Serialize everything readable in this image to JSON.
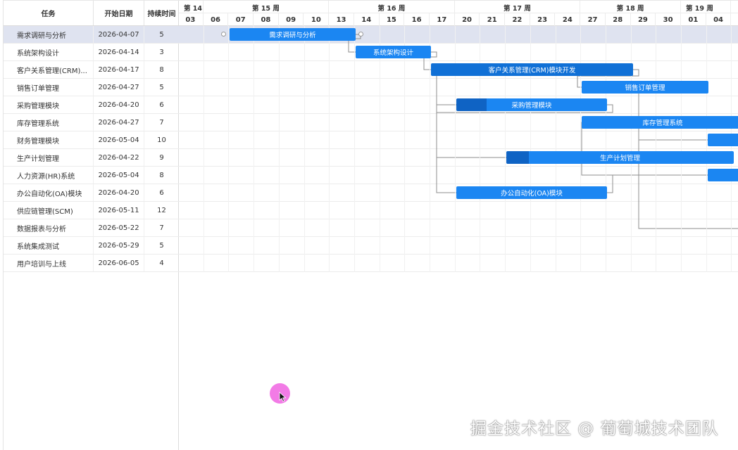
{
  "grid": {
    "headers": {
      "name": "任务",
      "start": "开始日期",
      "duration": "持续时间"
    },
    "rows": [
      {
        "name": "需求调研与分析",
        "start": "2026-04-07",
        "duration": "5"
      },
      {
        "name": "系统架构设计",
        "start": "2026-04-14",
        "duration": "3"
      },
      {
        "name": "客户关系管理(CRM)...",
        "start": "2026-04-17",
        "duration": "8"
      },
      {
        "name": "销售订单管理",
        "start": "2026-04-27",
        "duration": "5"
      },
      {
        "name": "采购管理模块",
        "start": "2026-04-20",
        "duration": "6"
      },
      {
        "name": "库存管理系统",
        "start": "2026-04-27",
        "duration": "7"
      },
      {
        "name": "财务管理模块",
        "start": "2026-05-04",
        "duration": "10"
      },
      {
        "name": "生产计划管理",
        "start": "2026-04-22",
        "duration": "9"
      },
      {
        "name": "人力资源(HR)系统",
        "start": "2026-05-04",
        "duration": "8"
      },
      {
        "name": "办公自动化(OA)模块",
        "start": "2026-04-20",
        "duration": "6"
      },
      {
        "name": "供应链管理(SCM)",
        "start": "2026-05-11",
        "duration": "12"
      },
      {
        "name": "数据报表与分析",
        "start": "2026-05-22",
        "duration": "7"
      },
      {
        "name": "系统集成测试",
        "start": "2026-05-29",
        "duration": "5"
      },
      {
        "name": "用户培训与上线",
        "start": "2026-06-05",
        "duration": "4"
      }
    ]
  },
  "timeline": {
    "weeks": [
      "第 14 周",
      "第 15 周",
      "第 16 周",
      "第 17 周",
      "第 18 周",
      "第 19 周"
    ],
    "days": [
      "03",
      "06",
      "07",
      "08",
      "09",
      "10",
      "13",
      "14",
      "15",
      "16",
      "17",
      "20",
      "21",
      "22",
      "23",
      "24",
      "27",
      "28",
      "29",
      "30",
      "01",
      "04"
    ],
    "bars": [
      {
        "row": 0,
        "label": "需求调研与分析",
        "progress": 0
      },
      {
        "row": 1,
        "label": "系统架构设计",
        "progress": 0
      },
      {
        "row": 2,
        "label": "客户关系管理(CRM)模块开发",
        "progress": 0
      },
      {
        "row": 3,
        "label": "销售订单管理",
        "progress": 0
      },
      {
        "row": 4,
        "label": "采购管理模块",
        "progress": 0.2
      },
      {
        "row": 5,
        "label": "库存管理系统",
        "progress": 0
      },
      {
        "row": 6,
        "label": "",
        "progress": 0
      },
      {
        "row": 7,
        "label": "生产计划管理",
        "progress": 0.1
      },
      {
        "row": 8,
        "label": "",
        "progress": 0
      },
      {
        "row": 9,
        "label": "办公自动化(OA)模块",
        "progress": 0
      }
    ]
  },
  "watermark": "掘金技术社区 @ 葡萄城技术团队",
  "colors": {
    "bar": "#1b86f2",
    "bar_progress": "#0f63c4",
    "selected_row": "#dfe3f0",
    "cursor_highlight": "#f27be6"
  }
}
